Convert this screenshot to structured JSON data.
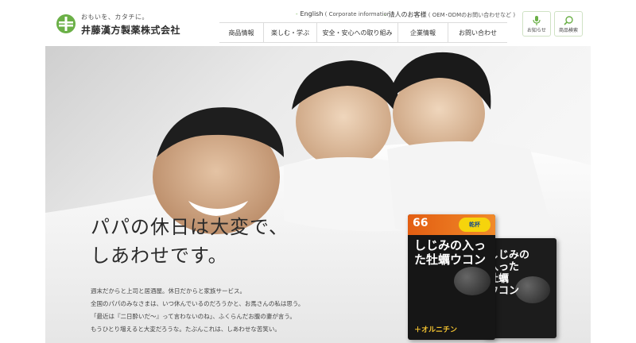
{
  "header": {
    "logo": {
      "tagline": "おもいを、カタチに。",
      "name": "井藤漢方製薬株式会社"
    },
    "util_links": [
      {
        "label": "English",
        "note": "( Corporate information )"
      },
      {
        "label": "法人のお客様",
        "note": "( OEM･ODMのお問い合わせなど )"
      }
    ],
    "gnav": [
      "商品情報",
      "楽しむ・学ぶ",
      "安全・安心への取り組み",
      "企業情報",
      "お問い合わせ"
    ],
    "buttons": {
      "news": "お知らせ",
      "product_search": "商品検索"
    }
  },
  "hero": {
    "headline": [
      "パパの休日は大変で、",
      "しあわせです。"
    ],
    "body": [
      "週末だからと上司と居酒屋。休日だからと家族サービス。",
      "全国のパパのみなさまは、いつ休んでいるのだろうかと、お馬さんの私は思う。",
      "「最近は『二日酔いだ〜』って言わないのね」、ふくらんだお腹の妻が言う。",
      "もうひとり増えると大変だろうな。たぶんこれは、しあわせな苦笑い。"
    ],
    "product": {
      "band_number": "66",
      "badge": "乾杯",
      "title": "しじみの入った牡蠣ウコン",
      "sub": "＋オルニチン"
    }
  },
  "colors": {
    "brand_green": "#6bb047",
    "accent_orange": "#e35e12"
  }
}
